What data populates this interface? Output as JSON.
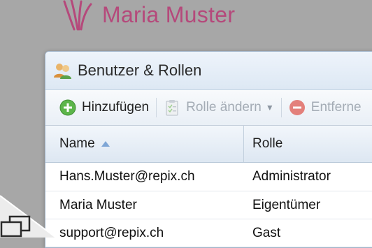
{
  "brand": {
    "name": "Maria Muster"
  },
  "window": {
    "title": "Benutzer & Rollen",
    "toolbar": {
      "add_label": "Hinzufügen",
      "change_role_label": "Rolle ändern",
      "remove_label": "Entferne"
    },
    "table": {
      "columns": [
        "Name",
        "Rolle"
      ],
      "rows": [
        {
          "name": "Hans.Muster@repix.ch",
          "role": "Administrator"
        },
        {
          "name": "Maria Muster",
          "role": "Eigentümer"
        },
        {
          "name": "support@repix.ch",
          "role": "Gast"
        }
      ]
    }
  },
  "colors": {
    "brand": "#b5497b",
    "background": "#a7a7a7",
    "add_green": "#5cb54a",
    "remove_red": "#e3807b"
  },
  "icons": [
    "brand-logo-icon",
    "users-icon",
    "add-icon",
    "clipboard-icon",
    "chevron-down-icon",
    "remove-icon",
    "sort-ascending-icon",
    "screen-icon"
  ]
}
